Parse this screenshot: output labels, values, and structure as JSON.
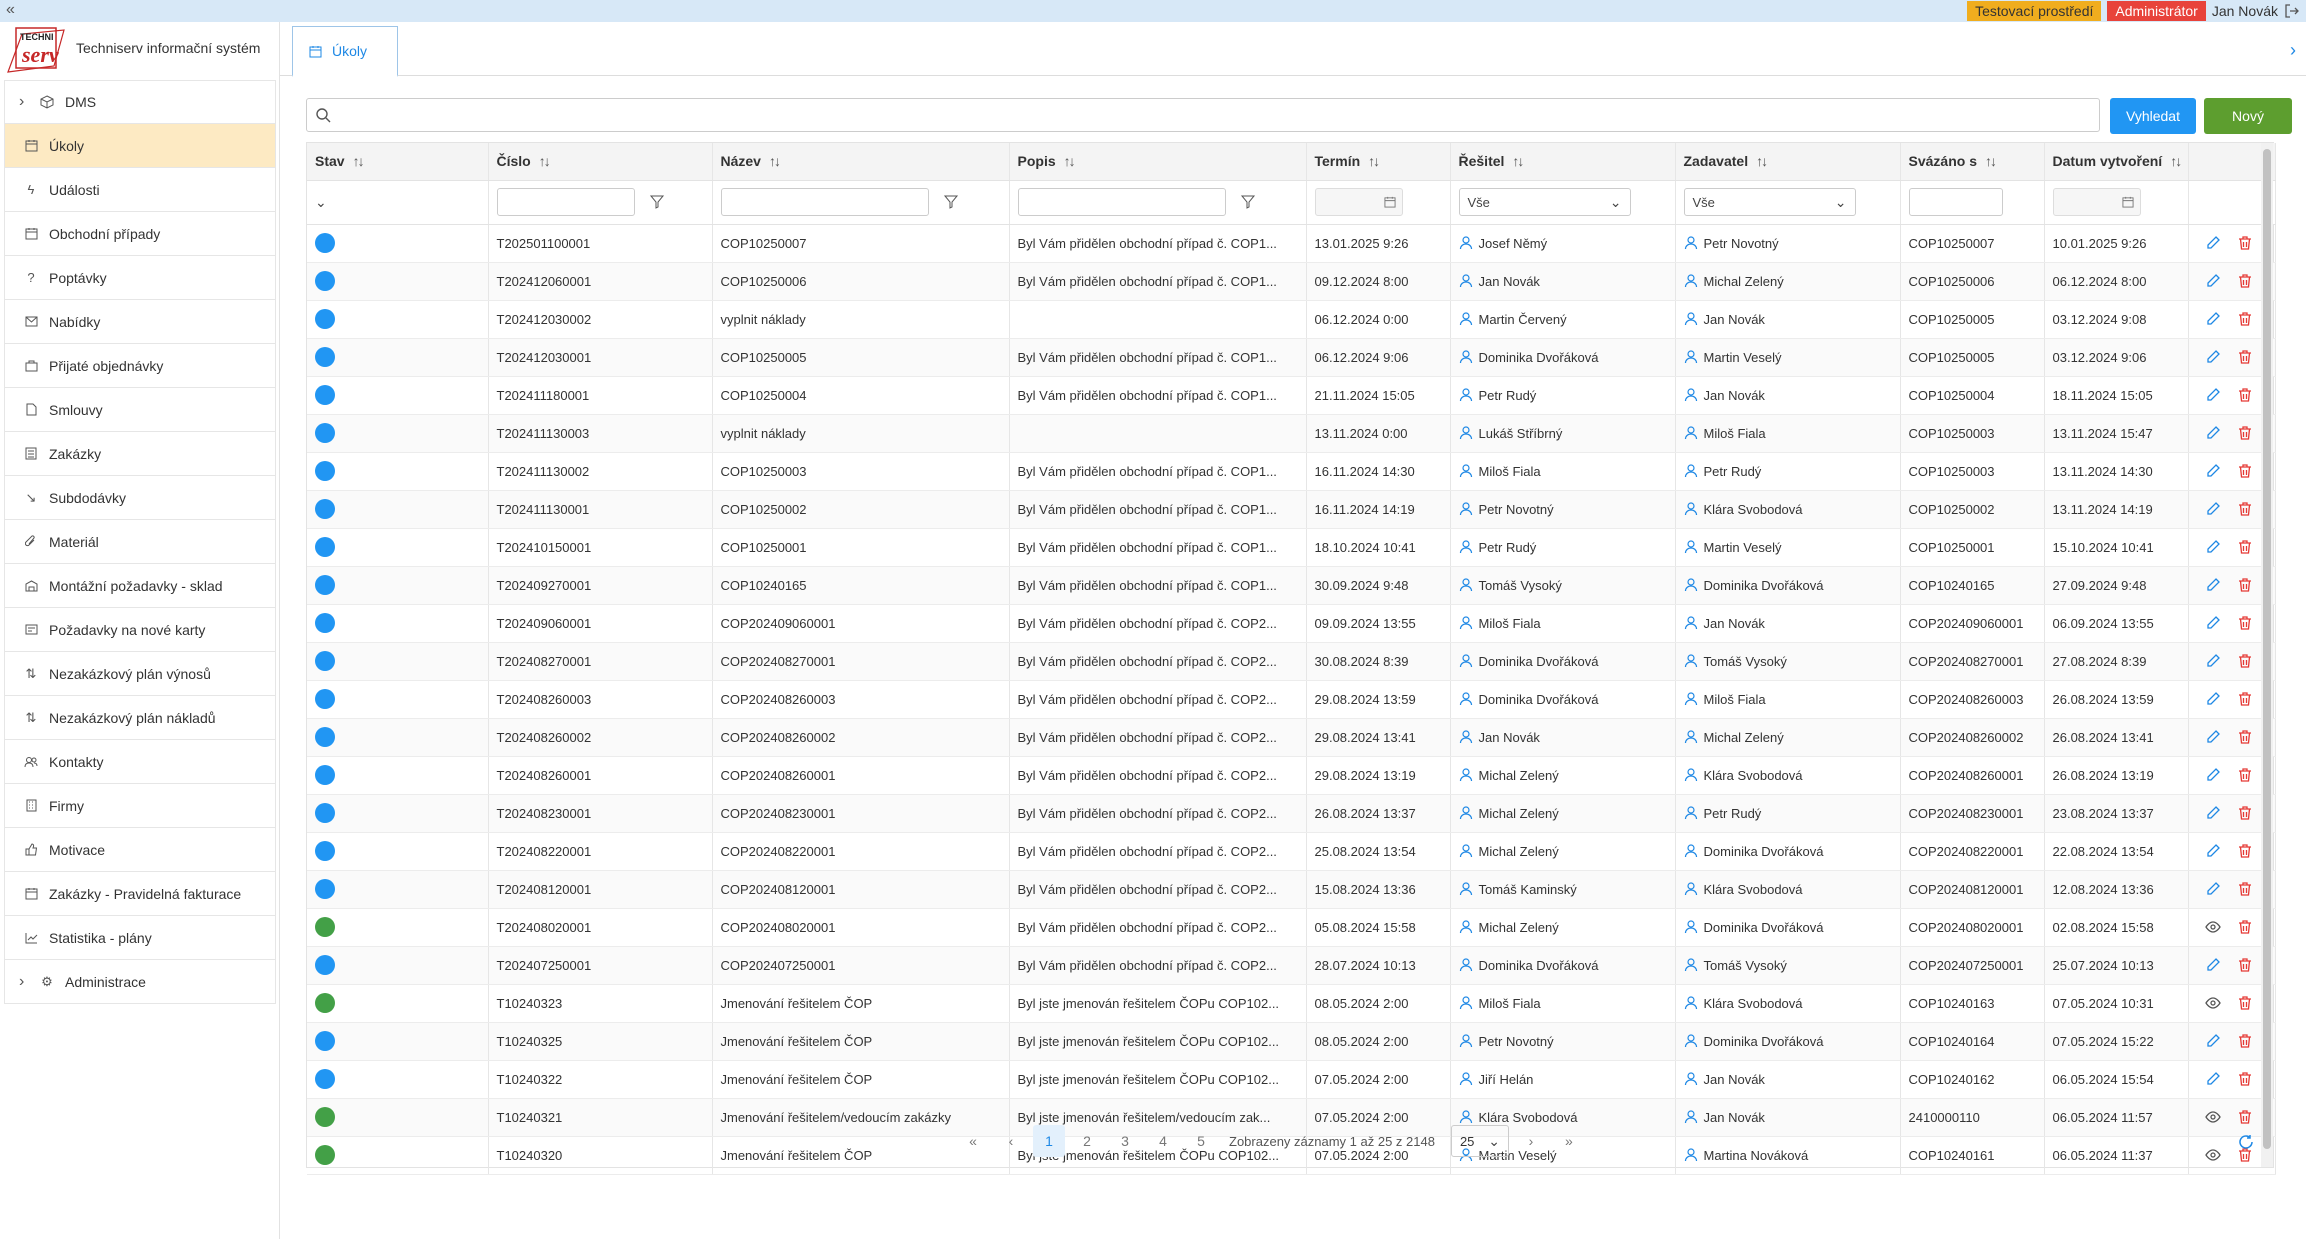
{
  "topbar": {
    "collapse_icon": "«",
    "env_badge": "Testovací prostředí",
    "role_badge": "Administrátor",
    "user_name": "Jan Novák",
    "env_color": "#f0ad1e",
    "role_color": "#e8433b"
  },
  "brand": {
    "logo_text": "TECHNI serv",
    "name": "Techniserv informační systém"
  },
  "sidebar": {
    "items": [
      {
        "label": "DMS",
        "icon": "cube-icon",
        "expandable": true
      },
      {
        "label": "Úkoly",
        "icon": "calendar-icon",
        "active": true
      },
      {
        "label": "Události",
        "icon": "lightning-icon"
      },
      {
        "label": "Obchodní případy",
        "icon": "calendar-icon"
      },
      {
        "label": "Poptávky",
        "icon": "question-icon"
      },
      {
        "label": "Nabídky",
        "icon": "envelope-icon"
      },
      {
        "label": "Přijaté objednávky",
        "icon": "briefcase-icon"
      },
      {
        "label": "Smlouvy",
        "icon": "document-icon"
      },
      {
        "label": "Zakázky",
        "icon": "list-icon"
      },
      {
        "label": "Subdodávky",
        "icon": "arrow-down-right-icon"
      },
      {
        "label": "Materiál",
        "icon": "paperclip-icon"
      },
      {
        "label": "Montážní požadavky - sklad",
        "icon": "warehouse-icon"
      },
      {
        "label": "Požadavky na nové karty",
        "icon": "card-icon"
      },
      {
        "label": "Nezakázkový plán výnosů",
        "icon": "sort-icon"
      },
      {
        "label": "Nezakázkový plán nákladů",
        "icon": "sort-icon"
      },
      {
        "label": "Kontakty",
        "icon": "users-icon"
      },
      {
        "label": "Firmy",
        "icon": "building-icon"
      },
      {
        "label": "Motivace",
        "icon": "thumbs-up-icon"
      },
      {
        "label": "Zakázky - Pravidelná fakturace",
        "icon": "calendar-icon"
      },
      {
        "label": "Statistika - plány",
        "icon": "chart-icon"
      },
      {
        "label": "Administrace",
        "icon": "gear-icon",
        "expandable": true
      }
    ]
  },
  "tabs": [
    {
      "label": "Úkoly",
      "icon": "calendar-icon"
    }
  ],
  "search": {
    "value": "",
    "placeholder": "",
    "search_button": "Vyhledat",
    "new_button": "Nový"
  },
  "columns": [
    "Stav",
    "Číslo",
    "Název",
    "Popis",
    "Termín",
    "Řešitel",
    "Zadavatel",
    "Svázáno s",
    "Datum vytvoření"
  ],
  "filters": {
    "resitel": "Vše",
    "zadavatel": "Vše"
  },
  "status_colors": {
    "open": "#2196f3",
    "done": "#43a047"
  },
  "rows": [
    {
      "status": "open",
      "cislo": "T202501100001",
      "nazev": "COP10250007",
      "popis": "Byl Vám přidělen obchodní případ č. COP1...",
      "termin": "13.01.2025 9:26",
      "resitel": "Josef Němý",
      "zadavatel": "Petr Novotný",
      "svazano": "COP10250007",
      "vytvoreno": "10.01.2025 9:26",
      "action": "edit"
    },
    {
      "status": "open",
      "cislo": "T202412060001",
      "nazev": "COP10250006",
      "popis": "Byl Vám přidělen obchodní případ č. COP1...",
      "termin": "09.12.2024 8:00",
      "resitel": "Jan Novák",
      "zadavatel": "Michal Zelený",
      "svazano": "COP10250006",
      "vytvoreno": "06.12.2024 8:00",
      "action": "edit"
    },
    {
      "status": "open",
      "cislo": "T202412030002",
      "nazev": "vyplnit náklady",
      "popis": "",
      "termin": "06.12.2024 0:00",
      "resitel": "Martin Červený",
      "zadavatel": "Jan Novák",
      "svazano": "COP10250005",
      "vytvoreno": "03.12.2024 9:08",
      "action": "edit"
    },
    {
      "status": "open",
      "cislo": "T202412030001",
      "nazev": "COP10250005",
      "popis": "Byl Vám přidělen obchodní případ č. COP1...",
      "termin": "06.12.2024 9:06",
      "resitel": "Dominika Dvořáková",
      "zadavatel": "Martin Veselý",
      "svazano": "COP10250005",
      "vytvoreno": "03.12.2024 9:06",
      "action": "edit"
    },
    {
      "status": "open",
      "cislo": "T202411180001",
      "nazev": "COP10250004",
      "popis": "Byl Vám přidělen obchodní případ č. COP1...",
      "termin": "21.11.2024 15:05",
      "resitel": "Petr Rudý",
      "zadavatel": "Jan Novák",
      "svazano": "COP10250004",
      "vytvoreno": "18.11.2024 15:05",
      "action": "edit"
    },
    {
      "status": "open",
      "cislo": "T202411130003",
      "nazev": "vyplnit náklady",
      "popis": "",
      "termin": "13.11.2024 0:00",
      "resitel": "Lukáš Stříbrný",
      "zadavatel": "Miloš Fiala",
      "svazano": "COP10250003",
      "vytvoreno": "13.11.2024 15:47",
      "action": "edit"
    },
    {
      "status": "open",
      "cislo": "T202411130002",
      "nazev": "COP10250003",
      "popis": "Byl Vám přidělen obchodní případ č. COP1...",
      "termin": "16.11.2024 14:30",
      "resitel": "Miloš Fiala",
      "zadavatel": "Petr Rudý",
      "svazano": "COP10250003",
      "vytvoreno": "13.11.2024 14:30",
      "action": "edit"
    },
    {
      "status": "open",
      "cislo": "T202411130001",
      "nazev": "COP10250002",
      "popis": "Byl Vám přidělen obchodní případ č. COP1...",
      "termin": "16.11.2024 14:19",
      "resitel": "Petr Novotný",
      "zadavatel": "Klára Svobodová",
      "svazano": "COP10250002",
      "vytvoreno": "13.11.2024 14:19",
      "action": "edit"
    },
    {
      "status": "open",
      "cislo": "T202410150001",
      "nazev": "COP10250001",
      "popis": "Byl Vám přidělen obchodní případ č. COP1...",
      "termin": "18.10.2024 10:41",
      "resitel": "Petr Rudý",
      "zadavatel": "Martin Veselý",
      "svazano": "COP10250001",
      "vytvoreno": "15.10.2024 10:41",
      "action": "edit"
    },
    {
      "status": "open",
      "cislo": "T202409270001",
      "nazev": "COP10240165",
      "popis": "Byl Vám přidělen obchodní případ č. COP1...",
      "termin": "30.09.2024 9:48",
      "resitel": "Tomáš Vysoký",
      "zadavatel": "Dominika Dvořáková",
      "svazano": "COP10240165",
      "vytvoreno": "27.09.2024 9:48",
      "action": "edit"
    },
    {
      "status": "open",
      "cislo": "T202409060001",
      "nazev": "COP202409060001",
      "popis": "Byl Vám přidělen obchodní případ č. COP2...",
      "termin": "09.09.2024 13:55",
      "resitel": "Miloš Fiala",
      "zadavatel": "Jan Novák",
      "svazano": "COP202409060001",
      "vytvoreno": "06.09.2024 13:55",
      "action": "edit"
    },
    {
      "status": "open",
      "cislo": "T202408270001",
      "nazev": "COP202408270001",
      "popis": "Byl Vám přidělen obchodní případ č. COP2...",
      "termin": "30.08.2024 8:39",
      "resitel": "Dominika Dvořáková",
      "zadavatel": "Tomáš Vysoký",
      "svazano": "COP202408270001",
      "vytvoreno": "27.08.2024 8:39",
      "action": "edit"
    },
    {
      "status": "open",
      "cislo": "T202408260003",
      "nazev": "COP202408260003",
      "popis": "Byl Vám přidělen obchodní případ č. COP2...",
      "termin": "29.08.2024 13:59",
      "resitel": "Dominika Dvořáková",
      "zadavatel": "Miloš Fiala",
      "svazano": "COP202408260003",
      "vytvoreno": "26.08.2024 13:59",
      "action": "edit"
    },
    {
      "status": "open",
      "cislo": "T202408260002",
      "nazev": "COP202408260002",
      "popis": "Byl Vám přidělen obchodní případ č. COP2...",
      "termin": "29.08.2024 13:41",
      "resitel": "Jan Novák",
      "zadavatel": "Michal Zelený",
      "svazano": "COP202408260002",
      "vytvoreno": "26.08.2024 13:41",
      "action": "edit"
    },
    {
      "status": "open",
      "cislo": "T202408260001",
      "nazev": "COP202408260001",
      "popis": "Byl Vám přidělen obchodní případ č. COP2...",
      "termin": "29.08.2024 13:19",
      "resitel": "Michal Zelený",
      "zadavatel": "Klára Svobodová",
      "svazano": "COP202408260001",
      "vytvoreno": "26.08.2024 13:19",
      "action": "edit"
    },
    {
      "status": "open",
      "cislo": "T202408230001",
      "nazev": "COP202408230001",
      "popis": "Byl Vám přidělen obchodní případ č. COP2...",
      "termin": "26.08.2024 13:37",
      "resitel": "Michal Zelený",
      "zadavatel": "Petr Rudý",
      "svazano": "COP202408230001",
      "vytvoreno": "23.08.2024 13:37",
      "action": "edit"
    },
    {
      "status": "open",
      "cislo": "T202408220001",
      "nazev": "COP202408220001",
      "popis": "Byl Vám přidělen obchodní případ č. COP2...",
      "termin": "25.08.2024 13:54",
      "resitel": "Michal Zelený",
      "zadavatel": "Dominika Dvořáková",
      "svazano": "COP202408220001",
      "vytvoreno": "22.08.2024 13:54",
      "action": "edit"
    },
    {
      "status": "open",
      "cislo": "T202408120001",
      "nazev": "COP202408120001",
      "popis": "Byl Vám přidělen obchodní případ č. COP2...",
      "termin": "15.08.2024 13:36",
      "resitel": "Tomáš Kaminský",
      "zadavatel": "Klára Svobodová",
      "svazano": "COP202408120001",
      "vytvoreno": "12.08.2024 13:36",
      "action": "edit"
    },
    {
      "status": "done",
      "cislo": "T202408020001",
      "nazev": "COP202408020001",
      "popis": "Byl Vám přidělen obchodní případ č. COP2...",
      "termin": "05.08.2024 15:58",
      "resitel": "Michal Zelený",
      "zadavatel": "Dominika Dvořáková",
      "svazano": "COP202408020001",
      "vytvoreno": "02.08.2024 15:58",
      "action": "view"
    },
    {
      "status": "open",
      "cislo": "T202407250001",
      "nazev": "COP202407250001",
      "popis": "Byl Vám přidělen obchodní případ č. COP2...",
      "termin": "28.07.2024 10:13",
      "resitel": "Dominika Dvořáková",
      "zadavatel": "Tomáš Vysoký",
      "svazano": "COP202407250001",
      "vytvoreno": "25.07.2024 10:13",
      "action": "edit"
    },
    {
      "status": "done",
      "cislo": "T10240323",
      "nazev": "Jmenování řešitelem ČOP",
      "popis": "Byl jste jmenován řešitelem ČOPu COP102...",
      "termin": "08.05.2024 2:00",
      "resitel": "Miloš Fiala",
      "zadavatel": "Klára Svobodová",
      "svazano": "COP10240163",
      "vytvoreno": "07.05.2024 10:31",
      "action": "view"
    },
    {
      "status": "open",
      "cislo": "T10240325",
      "nazev": "Jmenování řešitelem ČOP",
      "popis": "Byl jste jmenován řešitelem ČOPu COP102...",
      "termin": "08.05.2024 2:00",
      "resitel": "Petr Novotný",
      "zadavatel": "Dominika Dvořáková",
      "svazano": "COP10240164",
      "vytvoreno": "07.05.2024 15:22",
      "action": "edit"
    },
    {
      "status": "open",
      "cislo": "T10240322",
      "nazev": "Jmenování řešitelem ČOP",
      "popis": "Byl jste jmenován řešitelem ČOPu COP102...",
      "termin": "07.05.2024 2:00",
      "resitel": "Jiří Helán",
      "zadavatel": "Jan Novák",
      "svazano": "COP10240162",
      "vytvoreno": "06.05.2024 15:54",
      "action": "edit"
    },
    {
      "status": "done",
      "cislo": "T10240321",
      "nazev": "Jmenování řešitelem/vedoucím zakázky",
      "popis": "Byl jste jmenován řešitelem/vedoucím zak...",
      "termin": "07.05.2024 2:00",
      "resitel": "Klára Svobodová",
      "zadavatel": "Jan Novák",
      "svazano": "2410000110",
      "vytvoreno": "06.05.2024 11:57",
      "action": "view"
    },
    {
      "status": "done",
      "cislo": "T10240320",
      "nazev": "Jmenování řešitelem ČOP",
      "popis": "Byl jste jmenován řešitelem ČOPu COP102...",
      "termin": "07.05.2024 2:00",
      "resitel": "Martin Veselý",
      "zadavatel": "Martina Nováková",
      "svazano": "COP10240161",
      "vytvoreno": "06.05.2024 11:37",
      "action": "view"
    }
  ],
  "pagination": {
    "first": "«",
    "prev": "‹",
    "next": "›",
    "last": "»",
    "pages": [
      "1",
      "2",
      "3",
      "4",
      "5"
    ],
    "current": "1",
    "info": "Zobrazeny záznamy 1 až 25 z 2148",
    "page_size": "25"
  }
}
